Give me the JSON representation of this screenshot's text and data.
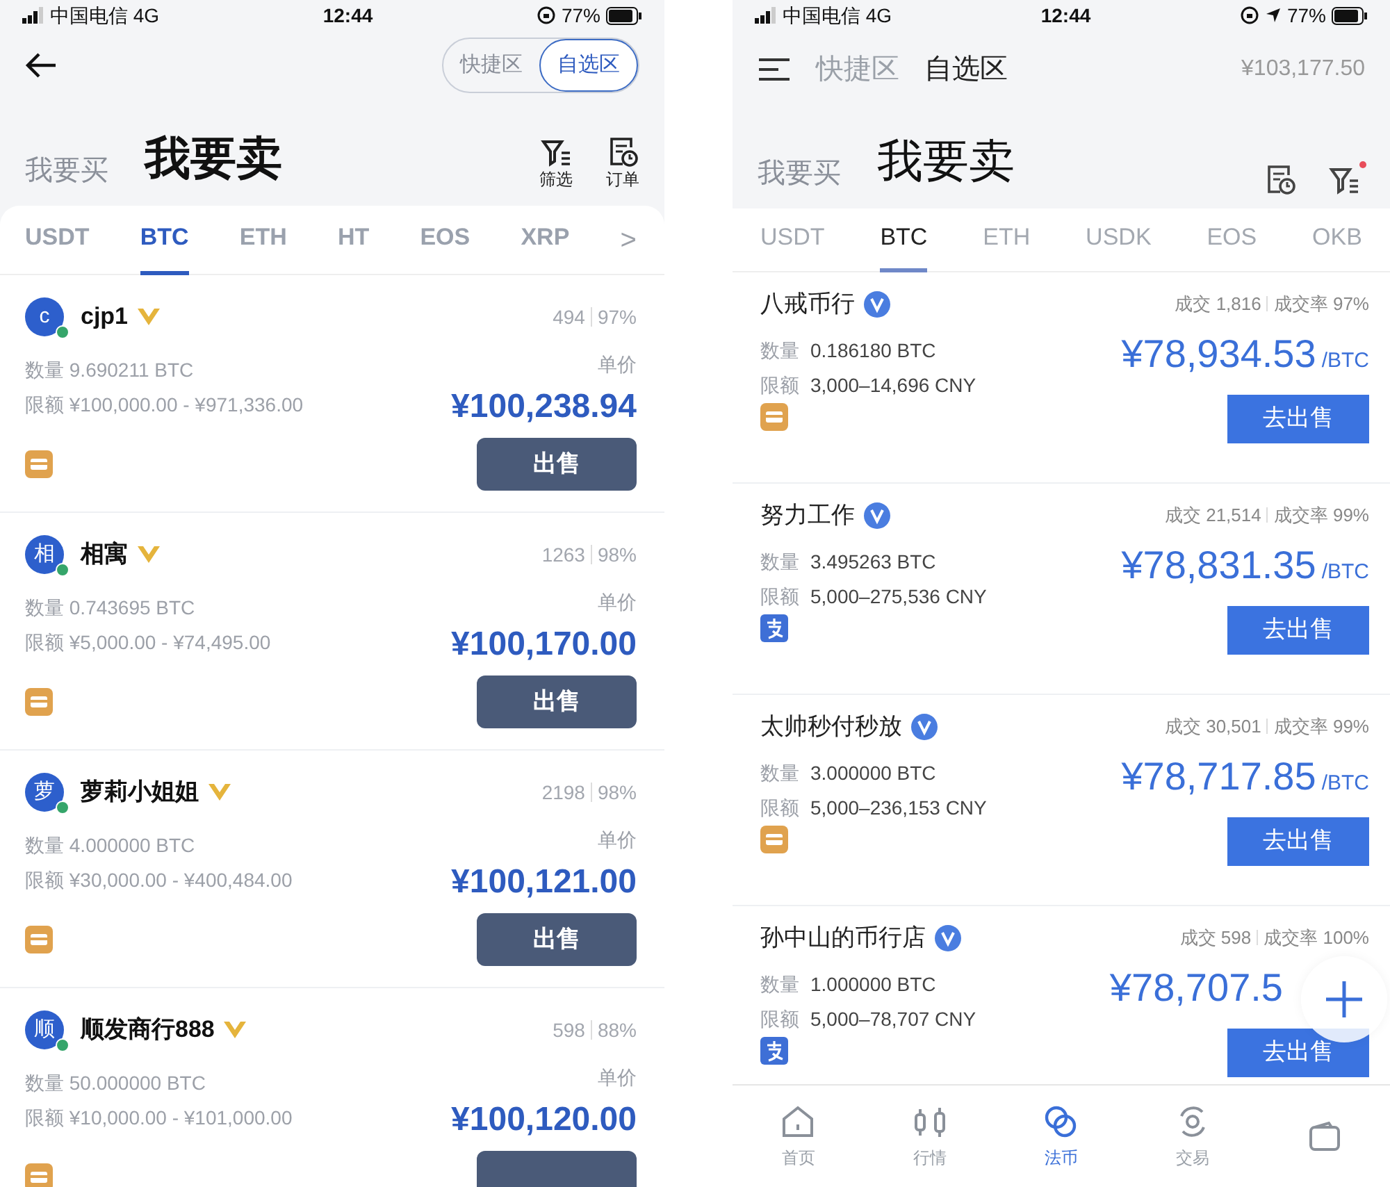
{
  "left": {
    "status_bar": {
      "carrier": "中国电信  4G",
      "time": "12:44",
      "battery": "77%"
    },
    "segments": [
      {
        "label": "快捷区",
        "selected": false
      },
      {
        "label": "自选区",
        "selected": true
      }
    ],
    "side_tabs": [
      {
        "label": "我要买",
        "selected": false
      },
      {
        "label": "我要卖",
        "selected": true
      }
    ],
    "tools": [
      {
        "kind": "filter",
        "label": "筛选"
      },
      {
        "kind": "orders",
        "label": "订单"
      }
    ],
    "coins": [
      {
        "label": "USDT",
        "selected": false
      },
      {
        "label": "BTC",
        "selected": true
      },
      {
        "label": "ETH",
        "selected": false
      },
      {
        "label": "HT",
        "selected": false
      },
      {
        "label": "EOS",
        "selected": false
      },
      {
        "label": "XRP",
        "selected": false
      }
    ],
    "more": ">",
    "listings": [
      {
        "avatar": "c",
        "name": "cjp1",
        "trades": "494",
        "rate": "97%",
        "amount_label": "数量",
        "amount": "9.690211 BTC",
        "limit_label": "限额",
        "limit": "¥100,000.00 - ¥971,336.00",
        "price_label": "单价",
        "price": "¥100,238.94",
        "payments": [
          {
            "kind": "bank"
          }
        ],
        "button": "出售"
      },
      {
        "avatar": "相",
        "name": "相寓",
        "trades": "1263",
        "rate": "98%",
        "amount_label": "数量",
        "amount": "0.743695 BTC",
        "limit_label": "限额",
        "limit": "¥5,000.00 - ¥74,495.00",
        "price_label": "单价",
        "price": "¥100,170.00",
        "payments": [
          {
            "kind": "bank"
          }
        ],
        "button": "出售"
      },
      {
        "avatar": "萝",
        "name": "萝莉小姐姐",
        "trades": "2198",
        "rate": "98%",
        "amount_label": "数量",
        "amount": "4.000000 BTC",
        "limit_label": "限额",
        "limit": "¥30,000.00 - ¥400,484.00",
        "price_label": "单价",
        "price": "¥100,121.00",
        "payments": [
          {
            "kind": "bank"
          }
        ],
        "button": "出售"
      },
      {
        "avatar": "顺",
        "name": "顺发商行888",
        "trades": "598",
        "rate": "88%",
        "amount_label": "数量",
        "amount": "50.000000 BTC",
        "limit_label": "限额",
        "limit": "¥10,000.00 - ¥101,000.00",
        "price_label": "单价",
        "price": "¥100,120.00",
        "payments": [
          {
            "kind": "bank"
          }
        ]
      }
    ]
  },
  "right": {
    "status_bar": {
      "carrier": "中国电信  4G",
      "time": "12:44",
      "battery": "77%"
    },
    "segments": [
      {
        "label": "快捷区",
        "selected": false
      },
      {
        "label": "自选区",
        "selected": true
      }
    ],
    "balance": "¥103,177.50",
    "side_tabs": [
      {
        "label": "我要买",
        "selected": false
      },
      {
        "label": "我要卖",
        "selected": true
      }
    ],
    "tools": [
      {
        "kind": "orders"
      },
      {
        "kind": "filter"
      }
    ],
    "coins": [
      {
        "label": "USDT",
        "selected": false
      },
      {
        "label": "BTC",
        "selected": true
      },
      {
        "label": "ETH",
        "selected": false
      },
      {
        "label": "USDK",
        "selected": false
      },
      {
        "label": "EOS",
        "selected": false
      },
      {
        "label": "OKB",
        "selected": false
      }
    ],
    "listings": [
      {
        "name": "八戒币行",
        "trades": "成交 1,816",
        "rate": "成交率 97%",
        "amount_label": "数量",
        "amount": "0.186180 BTC",
        "limit_label": "限额",
        "limit": "3,000–14,696 CNY",
        "price": "¥78,934.53",
        "unit": "/BTC",
        "payments": [
          {
            "kind": "bank"
          }
        ],
        "button": "去出售"
      },
      {
        "name": "努力工作",
        "trades": "成交 21,514",
        "rate": "成交率 99%",
        "amount_label": "数量",
        "amount": "3.495263 BTC",
        "limit_label": "限额",
        "limit": "5,000–275,536 CNY",
        "price": "¥78,831.35",
        "unit": "/BTC",
        "payments": [
          {
            "kind": "alipay"
          }
        ],
        "button": "去出售"
      },
      {
        "name": "太帅秒付秒放",
        "trades": "成交 30,501",
        "rate": "成交率 99%",
        "amount_label": "数量",
        "amount": "3.000000 BTC",
        "limit_label": "限额",
        "limit": "5,000–236,153 CNY",
        "price": "¥78,717.85",
        "unit": "/BTC",
        "payments": [
          {
            "kind": "bank"
          }
        ],
        "button": "去出售"
      },
      {
        "name": "孙中山的币行店",
        "trades": "成交 598",
        "rate": "成交率 100%",
        "amount_label": "数量",
        "amount": "1.000000 BTC",
        "limit_label": "限额",
        "limit": "5,000–78,707 CNY",
        "price": "¥78,707.5",
        "payments": [
          {
            "kind": "alipay"
          }
        ],
        "button": "去出售"
      }
    ],
    "nav": [
      {
        "kind": "home",
        "label": "首页",
        "selected": false
      },
      {
        "kind": "chart",
        "label": "行情",
        "selected": false
      },
      {
        "kind": "fiat",
        "label": "法币",
        "selected": true
      },
      {
        "kind": "trade",
        "label": "交易",
        "selected": false
      },
      {
        "kind": "wallet",
        "selected": false
      }
    ]
  }
}
